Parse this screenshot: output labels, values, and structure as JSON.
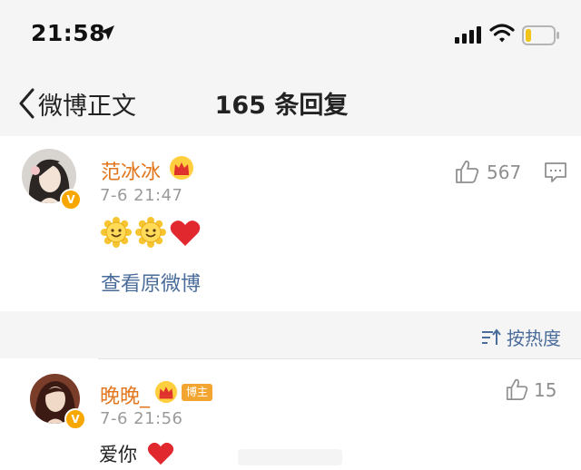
{
  "status_bar": {
    "time": "21:58"
  },
  "nav": {
    "back_label": "微博正文",
    "title": "165 条回复"
  },
  "main_comment": {
    "username": "范冰冰",
    "timestamp": "7-6 21:47",
    "likes": "567",
    "view_original": "查看原微博",
    "verified_badge": "V"
  },
  "sort": {
    "label": "按热度"
  },
  "reply": {
    "username": "晚晚_",
    "badge": "博主",
    "timestamp": "7-6 21:56",
    "text": "爱你",
    "likes": "15",
    "verified_badge": "V"
  },
  "colors": {
    "username": "#e2761d",
    "link": "#4a6c9a",
    "muted": "#9b9b9b",
    "verified": "#f7a700",
    "heart": "#e0282e"
  }
}
